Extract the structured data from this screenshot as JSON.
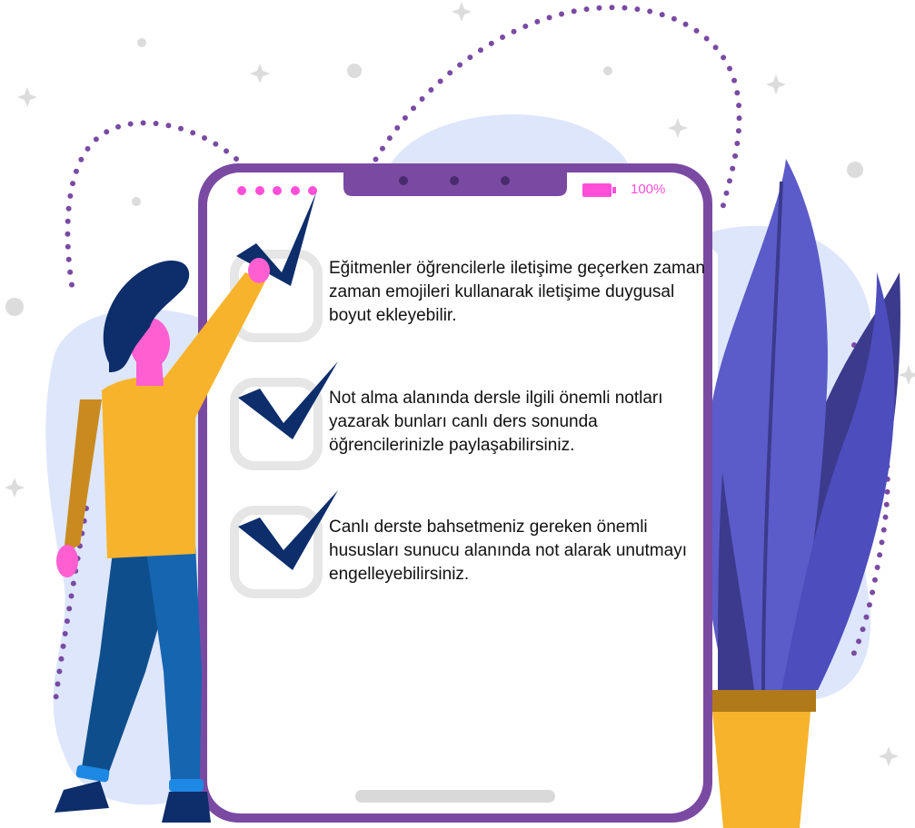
{
  "phone": {
    "status_bar": {
      "battery_percent": "100%",
      "signal_dots": 5
    },
    "checklist": [
      {
        "text": "Eğitmenler öğrencilerle iletişime geçerken zaman zaman emojileri kullanarak iletişime duygusal boyut ekleyebilir.",
        "checked": true
      },
      {
        "text": "Not alma alanında dersle ilgili önemli notları yazarak bunları canlı ders sonunda öğrencilerinizle paylaşabilirsiniz.",
        "checked": true
      },
      {
        "text": "Canlı derste bahsetmeniz gereken önemli hususları sunucu alanında not alarak unutmayı engelleyebilirsiniz.",
        "checked": true
      }
    ]
  },
  "colors": {
    "phone_frame": "#7a4aa3",
    "checkmark": "#0d2d6b",
    "battery": "#ff4fd8",
    "checkbox": "#e6e6e6",
    "blob": "#dde6fb",
    "plant_leaf": "#5b5bc9",
    "plant_leaf_dark": "#3b3a8c",
    "pot": "#f7b32b",
    "pot_rim": "#b07a1a",
    "shirt": "#f7b32b",
    "pants": "#0f4e8c",
    "hair": "#0d2d6b",
    "skin": "#ff5fd1"
  },
  "icons": [
    "checkmark-icon",
    "checkbox-icon",
    "battery-icon",
    "camera-dot-icon",
    "sparkle-icon"
  ]
}
